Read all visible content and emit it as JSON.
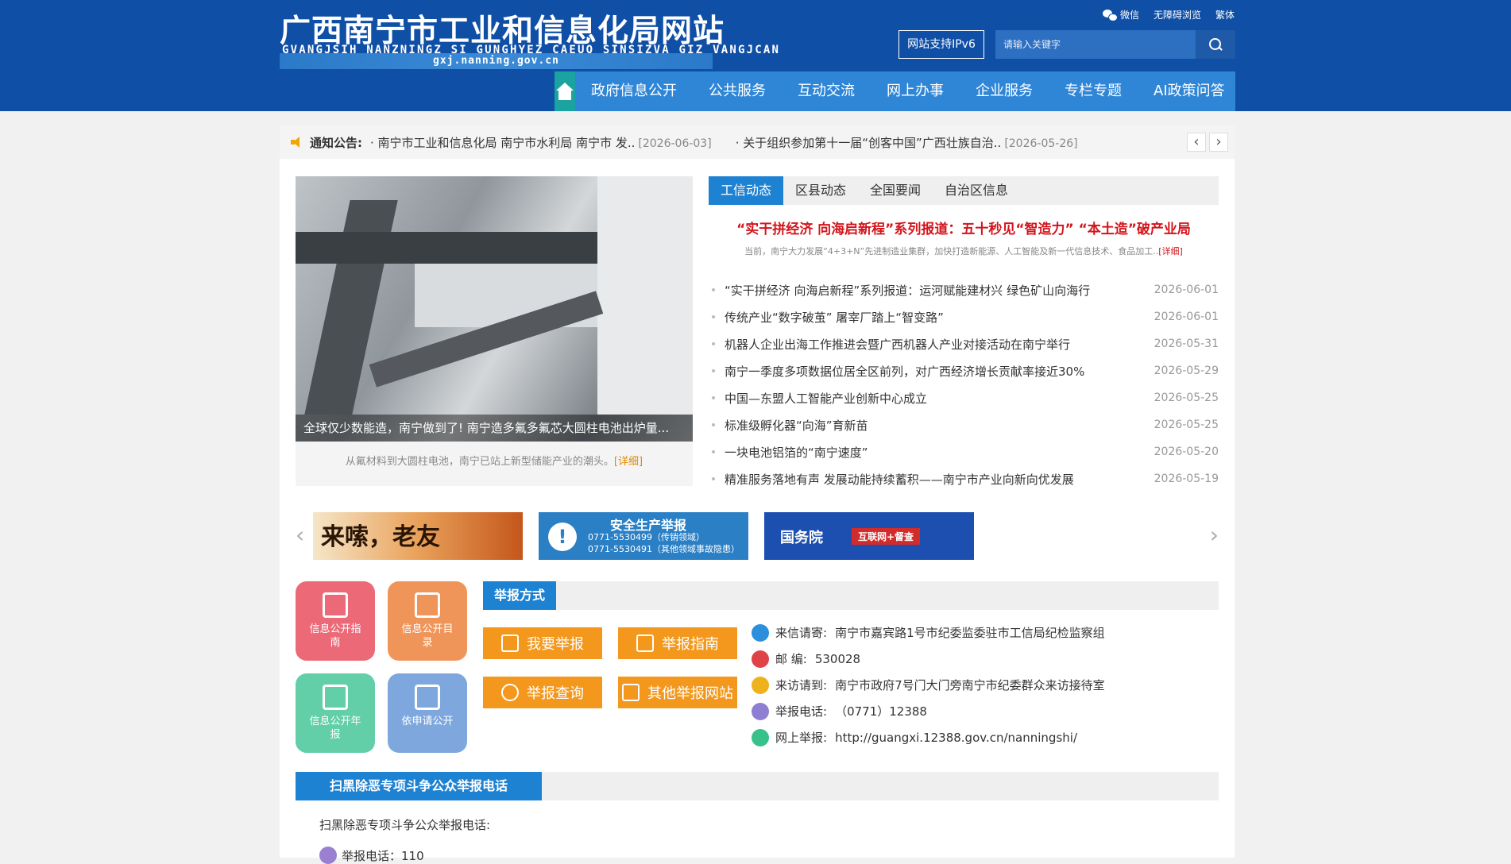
{
  "header": {
    "site_title": "广西南宁市工业和信息化局网站",
    "site_title_zhuang": "GVANGJSIH NANZNINGZ SI GUNGHYEZ CAEUQ SINSIZVA GIZ VANGJCAN",
    "domain": "gxj.nanning.gov.cn",
    "top_links": {
      "wechat": "微信",
      "accessible": "无障碍浏览",
      "traditional": "繁体"
    },
    "ipv6": "网站支持IPv6",
    "search_placeholder": "请输入关键字",
    "nav": [
      "政府信息公开",
      "公共服务",
      "互动交流",
      "网上办事",
      "企业服务",
      "专栏专题",
      "AI政策问答"
    ]
  },
  "notice": {
    "label": "通知公告:",
    "items": [
      {
        "title": "· 南宁市工业和信息化局 南宁市水利局 南宁市 发..",
        "date": "[2026-06-03]"
      },
      {
        "title": "· 关于组织参加第十一届“创客中国”广西壮族自治..",
        "date": "[2026-05-26]"
      }
    ],
    "prev": "‹",
    "next": "›"
  },
  "slide": {
    "caption": "全球仅少数能造，南宁做到了! 南宁造多氟多氟芯大圆柱电池出炉量...",
    "summary": "从氟材料到大圆柱电池，南宁已站上新型储能产业的潮头。",
    "more": "[详细]"
  },
  "news": {
    "tabs": [
      "工信动态",
      "区县动态",
      "全国要闻",
      "自治区信息"
    ],
    "headline": "“实干拼经济 向海启新程”系列报道：五十秒见“智造力” “本土造”破产业局",
    "headline_summary": "当前，南宁大力发展“4+3+N”先进制造业集群，加快打造新能源、人工智能及新一代信息技术、食品加工..",
    "headline_more": "[详细]",
    "items": [
      {
        "title": "“实干拼经济 向海启新程”系列报道：运河赋能建材兴 绿色矿山向海行",
        "date": "2026-06-01"
      },
      {
        "title": "传统产业“数字破茧” 屠宰厂踏上“智变路”",
        "date": "2026-06-01"
      },
      {
        "title": "机器人企业出海工作推进会暨广西机器人产业对接活动在南宁举行",
        "date": "2026-05-31"
      },
      {
        "title": "南宁一季度多项数据位居全区前列，对广西经济增长贡献率接近30%",
        "date": "2026-05-29"
      },
      {
        "title": "中国—东盟人工智能产业创新中心成立",
        "date": "2026-05-25"
      },
      {
        "title": "标准级孵化器“向海”育新苗",
        "date": "2026-05-25"
      },
      {
        "title": "一块电池铝箔的“南宁速度”",
        "date": "2026-05-20"
      },
      {
        "title": "精准服务落地有声 发展动能持续蓄积——南宁市产业向新向优发展",
        "date": "2026-05-19"
      }
    ]
  },
  "banners": {
    "b1": "来嗦，老友",
    "b2_title": "安全生产举报",
    "b2_lines": [
      "0771-5530499（传销领域）",
      "0771-5530491（其他领域事故隐患）"
    ],
    "b3_title": "国务院",
    "b3_tag": "互联网+督查"
  },
  "tiles": [
    {
      "label": "信息公开指南",
      "color": "#ec6a78"
    },
    {
      "label": "信息公开目录",
      "color": "#f0955a"
    },
    {
      "label": "信息公开年报",
      "color": "#62cfa9"
    },
    {
      "label": "依申请公开",
      "color": "#7ea8dd"
    }
  ],
  "report": {
    "title": "举报方式",
    "buttons": [
      "我要举报",
      "举报指南",
      "举报查询",
      "其他举报网站"
    ],
    "contacts": [
      {
        "key": "来信请寄:",
        "value": "南宁市嘉宾路1号市纪委监委驻市工信局纪检监察组",
        "color": "#2b8fdc"
      },
      {
        "key": "邮    编:",
        "value": "530028",
        "color": "#e0424a"
      },
      {
        "key": "来访请到:",
        "value": "南宁市政府7号门大门旁南宁市纪委群众来访接待室",
        "color": "#efb21c"
      },
      {
        "key": "举报电话:",
        "value": "（0771）12388",
        "color": "#8f7fd3"
      },
      {
        "key": "网上举报:",
        "value": "http://guangxi.12388.gov.cn/nanningshi/",
        "color": "#38c28a"
      }
    ]
  },
  "heie": {
    "title": "扫黑除恶专项斗争公众举报电话",
    "text": "扫黑除恶专项斗争公众举报电话:",
    "phone": "举报电话：110"
  }
}
